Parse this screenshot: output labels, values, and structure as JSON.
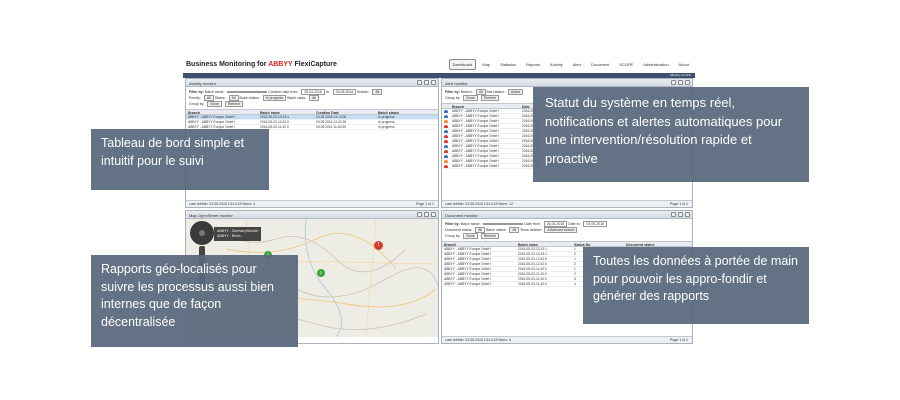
{
  "app": {
    "title_prefix": "Business Monitoring for ",
    "title_brand": "ABBYY",
    "title_suffix": " FlexiCapture",
    "tabs": [
      "Dashboard",
      "Map",
      "Statistics",
      "Reports",
      "Activity",
      "Alert",
      "Document",
      "SCOPE",
      "Administration",
      "About"
    ],
    "user": "Ministry Control"
  },
  "activity": {
    "title": "Activity monitor",
    "filter_label": "Filter by:",
    "batch_name_label": "Batch name:",
    "creation_label": "Creation date from:",
    "date_from": "26.04.2016",
    "to_label": "to:",
    "date_to": "03.05.2016",
    "branch_label": "Branch:",
    "branch_value": "All",
    "priority_label": "Priority:",
    "priority_value": "All",
    "status_label": "Status:",
    "status_value": "All",
    "batch_status_label": "Batch status:",
    "batch_status_value": "In progress",
    "batch_class_label": "Batch class:",
    "batch_class_value": "All",
    "group_label": "Group by:",
    "group_value": "None",
    "refresh": "Refresh",
    "columns": [
      "Branch",
      "Batch name",
      "Creation Date",
      "Batch status"
    ],
    "rows": [
      [
        "ABBYY - ABBYY Europe GmbH",
        "2016-05-03-13:13:1",
        "03.05.2016 13:13:00",
        "In progress"
      ],
      [
        "ABBYY - ABBYY Europe GmbH",
        "2016-05-03-12:42:0",
        "03.05.2016 12:42:26",
        "In progress"
      ],
      [
        "ABBYY - ABBYY Europe GmbH",
        "2016-05-03-11:40:3",
        "03.05.2016 11:40:39",
        "In progress"
      ]
    ],
    "footer": "Last refresh: 03.05.2016 13:14:23",
    "items": "Items: 3",
    "page_word": "Page",
    "page": "1",
    "of": "of 1"
  },
  "alert": {
    "title": "Alert monitor",
    "filter_label": "Filter by:",
    "branch_label": "Branch:",
    "branch_value": "All",
    "alert_label": "Alert status:",
    "alert_value": "Active",
    "group_label": "Group by:",
    "group_value": "None",
    "refresh": "Refresh",
    "columns": [
      "",
      "Branch",
      "Date"
    ],
    "rows": [
      [
        "ABBYY - ABBYY Europe GmbH",
        "2016-05-03"
      ],
      [
        "ABBYY - ABBYY Europe GmbH",
        "2016-05-03"
      ],
      [
        "ABBYY - ABBYY Europe GmbH",
        "2016-05-03"
      ],
      [
        "ABBYY - ABBYY Europe GmbH",
        "2016-05-03"
      ],
      [
        "ABBYY - ABBYY Europe GmbH",
        "2016-05-03"
      ],
      [
        "ABBYY - ABBYY Europe GmbH",
        "2016-05-03"
      ],
      [
        "ABBYY - ABBYY Europe GmbH",
        "2016-05-03"
      ],
      [
        "ABBYY - ABBYY Europe GmbH",
        "2016-05-03"
      ],
      [
        "ABBYY - ABBYY Europe GmbH",
        "2016-05-03"
      ],
      [
        "ABBYY - ABBYY Europe GmbH",
        "2016-05-03"
      ],
      [
        "ABBYY - ABBYY Europe GmbH",
        "2016-05-03"
      ],
      [
        "ABBYY - ABBYY Europe GmbH",
        "2016-05-03"
      ]
    ],
    "footer": "Last refresh: 03.05.2016 13:14:23",
    "items": "Items: 12",
    "page_word": "Page",
    "page": "1",
    "of": "of 1"
  },
  "map": {
    "title": "Map OpenStreet monitor",
    "refresh": "Refresh",
    "legend": [
      "ABBYY - Germany/Munich",
      "ABBYY - Berlin"
    ]
  },
  "document": {
    "title": "Document monitor",
    "filter_label": "Filter by:",
    "batch_name_label": "Batch name:",
    "date_from_label": "Date from:",
    "date_from": "26.04.2016",
    "date_to_label": "Date to:",
    "date_to": "03.05.2016",
    "document_label": "Document status:",
    "document_value": "All",
    "batch_status_label": "Batch status:",
    "batch_status_value": "All",
    "deleted_label": "Show deleted",
    "advanced": "Advanced search",
    "group_label": "Group by:",
    "group_value": "None",
    "refresh": "Refresh",
    "columns": [
      "Branch",
      "Batch name",
      "Status No",
      "Document status"
    ],
    "rows": [
      [
        "ABBYY - ABBYY Europe GmbH",
        "2016-05-03-13:13:1",
        "1"
      ],
      [
        "ABBYY - ABBYY Europe GmbH",
        "2016-05-03-13:13:1",
        "2"
      ],
      [
        "ABBYY - ABBYY Europe GmbH",
        "2016-05-03-12:42:0",
        "1"
      ],
      [
        "ABBYY - ABBYY Europe GmbH",
        "2016-05-03-12:42:0",
        "2"
      ],
      [
        "ABBYY - ABBYY Europe GmbH",
        "2016-05-03-11:40:3",
        "1"
      ],
      [
        "ABBYY - ABBYY Europe GmbH",
        "2016-05-03-11:40:3",
        "2"
      ],
      [
        "ABBYY - ABBYY Europe GmbH",
        "2016-05-03-11:40:3",
        "3"
      ],
      [
        "ABBYY - ABBYY Europe GmbH",
        "2016-05-03-11:40:3",
        "4"
      ]
    ],
    "footer": "Last refresh: 03.05.2016 13:14:23",
    "items": "Items: 8",
    "page_word": "Page",
    "page": "1",
    "of": "of 1"
  },
  "callouts": {
    "c1": "Tableau de bord simple et intuitif pour le suivi",
    "c2": "Statut du système en temps réel, notifications et alertes automatiques pour une intervention/résolution rapide et proactive",
    "c3": "Rapports géo-localisés pour suivre les processus aussi bien internes que de façon décentralisée",
    "c4": "Toutes les données à portée de main pour pouvoir les appro-fondir et générer des rapports"
  },
  "colors": {
    "callout_bg": "#58677c",
    "header_bar": "#3d4f6a",
    "brand_red": "#d9261c",
    "alert_red": "#d93a2b",
    "alert_orange": "#e8902b",
    "alert_blue": "#3b73c6",
    "marker_green": "#3ca63c"
  }
}
